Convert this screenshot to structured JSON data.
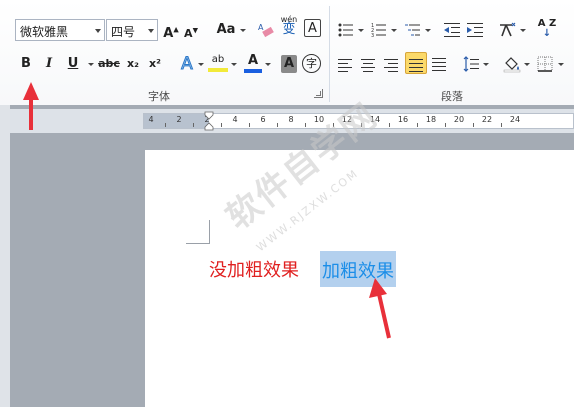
{
  "ribbon": {
    "font_name": "微软雅黑",
    "font_size": "四号",
    "grow_font_icon": "grow-font",
    "shrink_font_icon": "shrink-font",
    "change_case_label": "Aa",
    "clear_format_icon": "eraser",
    "pinyin_label": "wén",
    "pinyin_char": "变",
    "char_border_label": "A",
    "bold_label": "B",
    "italic_label": "I",
    "underline_label": "U",
    "strike_label": "abc",
    "subscript_label": "x₂",
    "superscript_label": "x²",
    "text_effect_label": "A",
    "highlight_label": "ab",
    "font_color_label": "A",
    "char_shading_label": "A",
    "enclose_char_label": "字",
    "sort_label": "A Z",
    "font_group_label": "字体",
    "paragraph_group_label": "段落",
    "active_alignment": "justify"
  },
  "ruler": {
    "labels": [
      "4",
      "2",
      "2",
      "4",
      "6",
      "8",
      "10",
      "12",
      "14",
      "16",
      "18",
      "20",
      "22",
      "24"
    ]
  },
  "document": {
    "text_normal": "没加粗效果",
    "text_bold": "加粗效果"
  },
  "watermark": {
    "text": "软件自学网",
    "url": "WWW.RJZXW.COM"
  },
  "colors": {
    "annotation_arrow": "#e8303a",
    "text_normal": "#e02020",
    "text_bold": "#1c8ee8",
    "selection": "#b3d0ee",
    "active_button": "#fbd969"
  }
}
